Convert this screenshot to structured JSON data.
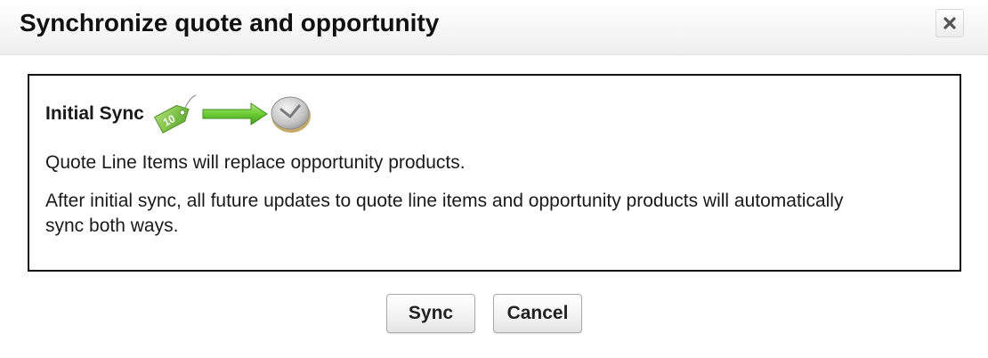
{
  "dialog": {
    "title": "Synchronize quote and opportunity",
    "close_icon": "close-icon"
  },
  "content": {
    "heading": "Initial Sync",
    "icons": [
      "price-tag-icon",
      "arrow-right-icon",
      "coin-icon"
    ],
    "tag_text": "10",
    "paragraph1": "Quote Line Items will replace opportunity products.",
    "paragraph2": "After initial sync, all future updates to quote line items and opportunity products will automatically sync both ways."
  },
  "buttons": {
    "sync_label": "Sync",
    "cancel_label": "Cancel"
  },
  "colors": {
    "tag_green": "#7cc142",
    "arrow_green": "#5fbf2a",
    "coin_gray": "#c9c9c9"
  }
}
